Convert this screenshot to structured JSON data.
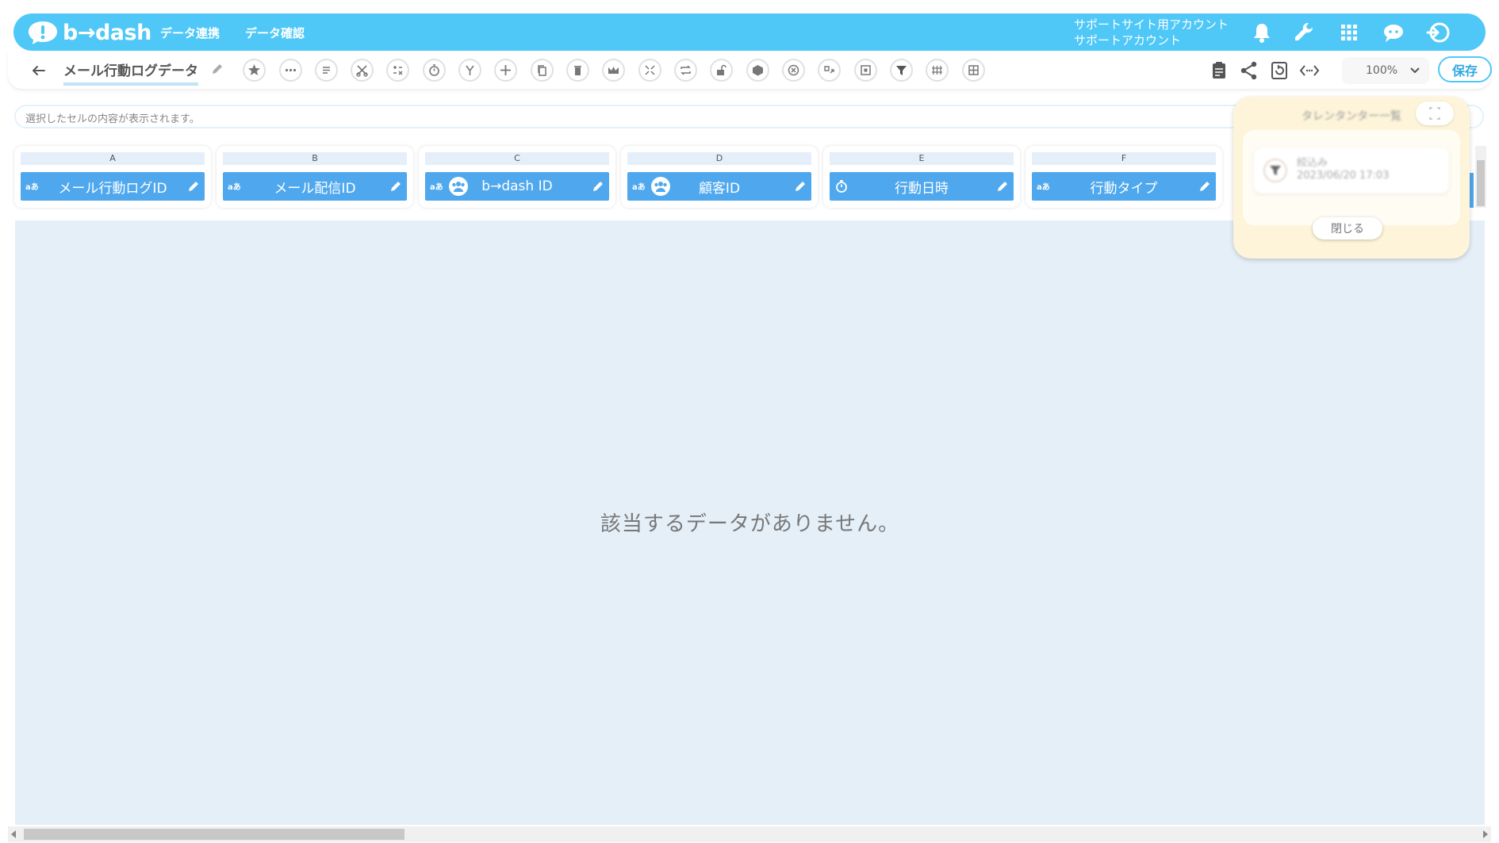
{
  "header": {
    "logo_text": "b→dash",
    "nav": [
      "データ連携",
      "データ確認"
    ],
    "account_line1": "サポートサイト用アカウント",
    "account_line2": "サポートアカウント"
  },
  "toolbar": {
    "title": "メール行動ログデータ",
    "zoom": "100%",
    "save_label": "保存"
  },
  "cellbar": {
    "placeholder": "選択したセルの内容が表示されます。"
  },
  "columns": [
    {
      "letter": "A",
      "label": "メール行動ログID",
      "type": "aあ",
      "icon": "text"
    },
    {
      "letter": "B",
      "label": "メール配信ID",
      "type": "aあ",
      "icon": "text"
    },
    {
      "letter": "C",
      "label": "b→dash ID",
      "type": "aあ",
      "icon": "people"
    },
    {
      "letter": "D",
      "label": "顧客ID",
      "type": "aあ",
      "icon": "people"
    },
    {
      "letter": "E",
      "label": "行動日時",
      "type": "",
      "icon": "timer"
    },
    {
      "letter": "F",
      "label": "行動タイプ",
      "type": "aあ",
      "icon": "text"
    }
  ],
  "data_area": {
    "empty_message": "該当するデータがありません。"
  },
  "panel": {
    "title": "タレンタンター一覧",
    "item_name": "絞込み",
    "item_date": "2023/06/20 17:03",
    "close_label": "閉じる"
  },
  "colors": {
    "accent": "#4fc8f7",
    "column_header": "#4fa8ee",
    "data_area": "#e5eff8",
    "panel": "#fdf4d9"
  }
}
